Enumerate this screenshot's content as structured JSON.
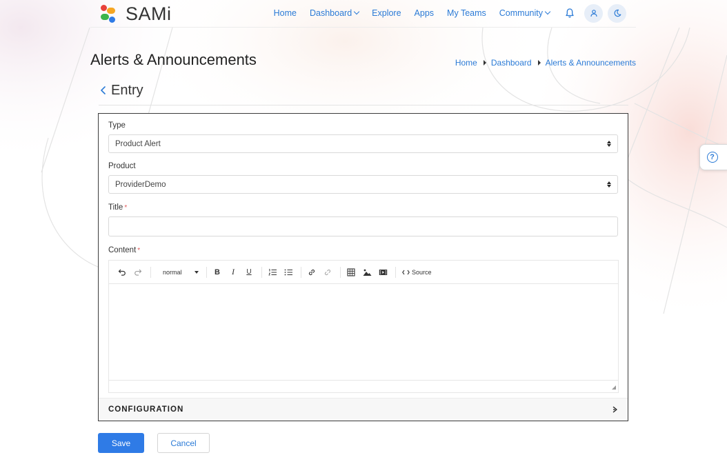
{
  "brand": {
    "name": "SAMi"
  },
  "nav": {
    "home": "Home",
    "dashboard": "Dashboard",
    "explore": "Explore",
    "apps": "Apps",
    "my_teams": "My Teams",
    "community": "Community"
  },
  "page": {
    "title": "Alerts & Announcements"
  },
  "breadcrumb": [
    "Home",
    "Dashboard",
    "Alerts & Announcements"
  ],
  "entry": {
    "title": "Entry"
  },
  "form": {
    "type": {
      "label": "Type",
      "value": "Product Alert"
    },
    "product": {
      "label": "Product",
      "value": "ProviderDemo"
    },
    "title_field": {
      "label": "Title",
      "required_mark": "*",
      "value": ""
    },
    "content": {
      "label": "Content",
      "required_mark": "*"
    }
  },
  "editor": {
    "format_value": "normal",
    "bold": "B",
    "italic": "I",
    "underline": "U",
    "source_label": "Source",
    "icons": [
      "undo-icon",
      "redo-icon",
      "bold-icon",
      "italic-icon",
      "underline-icon",
      "ordered-list-icon",
      "bullet-list-icon",
      "link-icon",
      "unlink-icon",
      "table-icon",
      "image-icon",
      "video-icon",
      "code-icon"
    ]
  },
  "configuration": {
    "title": "CONFIGURATION"
  },
  "actions": {
    "save": "Save",
    "cancel": "Cancel"
  },
  "help": {
    "label": "?"
  },
  "colors": {
    "accent": "#2a7ad6",
    "primary_button": "#2f7be6",
    "required": "#e05a5a",
    "logo_red": "#e8413a",
    "logo_orange": "#f6a623",
    "logo_green": "#3bb54a",
    "logo_blue": "#2f7be6"
  }
}
